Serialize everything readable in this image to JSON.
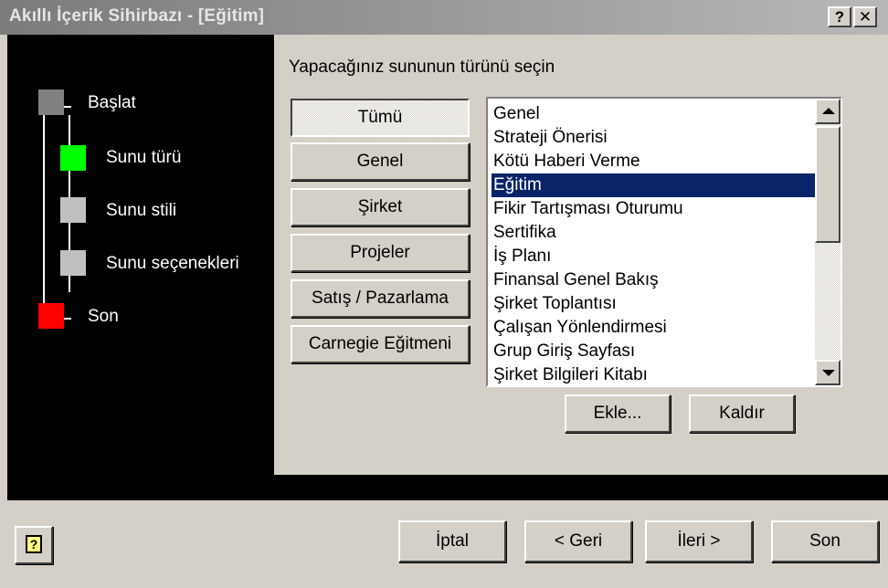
{
  "window": {
    "title": "Akıllı İçerik Sihirbazı - [Eğitim]",
    "help_button": "?",
    "close_button": "✕"
  },
  "steps": [
    {
      "label": "Başlat",
      "color": "#808080"
    },
    {
      "label": "Sunu türü",
      "color": "#00ff00"
    },
    {
      "label": "Sunu stili",
      "color": "#c0c0c0"
    },
    {
      "label": "Sunu seçenekleri",
      "color": "#c0c0c0"
    },
    {
      "label": "Son",
      "color": "#ff0000"
    }
  ],
  "prompt": "Yapacağınız sununun türünü seçin",
  "categories": [
    {
      "label": "Tümü",
      "pressed": true
    },
    {
      "label": "Genel",
      "pressed": false
    },
    {
      "label": "Şirket",
      "pressed": false
    },
    {
      "label": "Projeler",
      "pressed": false
    },
    {
      "label": "Satış / Pazarlama",
      "pressed": false
    },
    {
      "label": "Carnegie Eğitmeni",
      "pressed": false
    }
  ],
  "list": {
    "items": [
      "Genel",
      "Strateji Önerisi",
      "Kötü Haberi Verme",
      "Eğitim",
      "Fikir Tartışması Oturumu",
      "Sertifika",
      "İş Planı",
      "Finansal Genel Bakış",
      "Şirket Toplantısı",
      "Çalışan Yönlendirmesi",
      "Grup Giriş Sayfası",
      "Şirket Bilgileri Kitabı"
    ],
    "selected": "Eğitim",
    "selection_color": "#0a246a"
  },
  "list_actions": {
    "add": "Ekle...",
    "remove": "Kaldır"
  },
  "footer": {
    "cancel": "İptal",
    "back": "< Geri",
    "next": "İleri >",
    "finish": "Son"
  }
}
